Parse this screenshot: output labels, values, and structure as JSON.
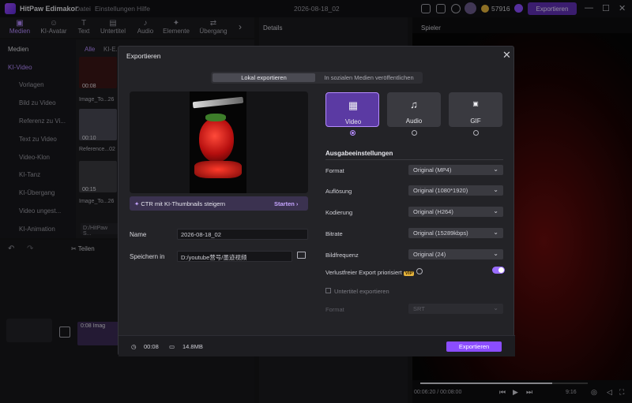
{
  "app": {
    "title": "HitPaw Edimakor",
    "menu": [
      "Datei",
      "Einstellungen",
      "Hilfe"
    ],
    "datetime": "2026-08-18_02",
    "credits": "57916",
    "export_label": "Exportieren"
  },
  "toolbar": {
    "items": [
      {
        "label": "Medien",
        "icon": "folder-icon"
      },
      {
        "label": "KI-Avatar",
        "icon": "avatar-icon"
      },
      {
        "label": "Text",
        "icon": "text-icon"
      },
      {
        "label": "Untertitel",
        "icon": "subtitle-icon"
      },
      {
        "label": "Audio",
        "icon": "music-icon"
      },
      {
        "label": "Elemente",
        "icon": "elements-icon"
      },
      {
        "label": "Übergang",
        "icon": "transition-icon"
      }
    ]
  },
  "panels": {
    "details": "Details",
    "player": "Spieler"
  },
  "sidebar": {
    "items": [
      "Medien",
      "KI-Video",
      "Vorlagen",
      "Bild zu Video",
      "Referenz zu Vi...",
      "Text zu Video",
      "Video-Klon",
      "KI-Tanz",
      "KI-Übergang",
      "Video ungest...",
      "KI-Animation"
    ]
  },
  "media": {
    "tabs": [
      "Alle",
      "KI-E..."
    ],
    "clips": [
      {
        "time": "00:08",
        "name": "Image_To...26"
      },
      {
        "time": "00:10",
        "name": "Reference...02"
      },
      {
        "time": "00:15",
        "name": "Image_To...26"
      }
    ],
    "path": "D:/HitPaw S..."
  },
  "timeline": {
    "split": "Teilen",
    "clip": "0:08 Imag"
  },
  "modal": {
    "title": "Exportieren",
    "tabs": [
      "Lokal exportieren",
      "In sozialen Medien veröffentlichen"
    ],
    "ctr_text": "CTR mit KI-Thumbnails steigern",
    "ctr_action": "Starten",
    "name_label": "Name",
    "name_value": "2026-08-18_02",
    "save_label": "Speichern in",
    "save_value": "D:/youtube营号/墨迹视频",
    "formats": [
      {
        "label": "Video",
        "icon": "clapper-icon"
      },
      {
        "label": "Audio",
        "icon": "music-icon"
      },
      {
        "label": "GIF",
        "icon": "gif-icon"
      }
    ],
    "selected_format": "Video",
    "section": "Ausgabeeinstellungen",
    "settings": [
      {
        "label": "Format",
        "value": "Original (MP4)"
      },
      {
        "label": "Auflösung",
        "value": "Original (1080*1920)"
      },
      {
        "label": "Kodierung",
        "value": "Original (H264)"
      },
      {
        "label": "Bitrate",
        "value": "Original (15289kbps)"
      },
      {
        "label": "Bildfrequenz",
        "value": "Original (24)"
      }
    ],
    "lossless_label": "Verlustfreier Export priorisiert",
    "vip": "VIP",
    "lossless_on": true,
    "subtitle_label": "Untertitel exportieren",
    "subtitle_format_label": "Format",
    "subtitle_format_value": "SRT",
    "duration": "00:08",
    "size": "14.8MB",
    "export_button": "Exportieren"
  },
  "player": {
    "time": "00:06:20 / 00:08:00",
    "ratio": "9:16",
    "progress": 0.79
  }
}
